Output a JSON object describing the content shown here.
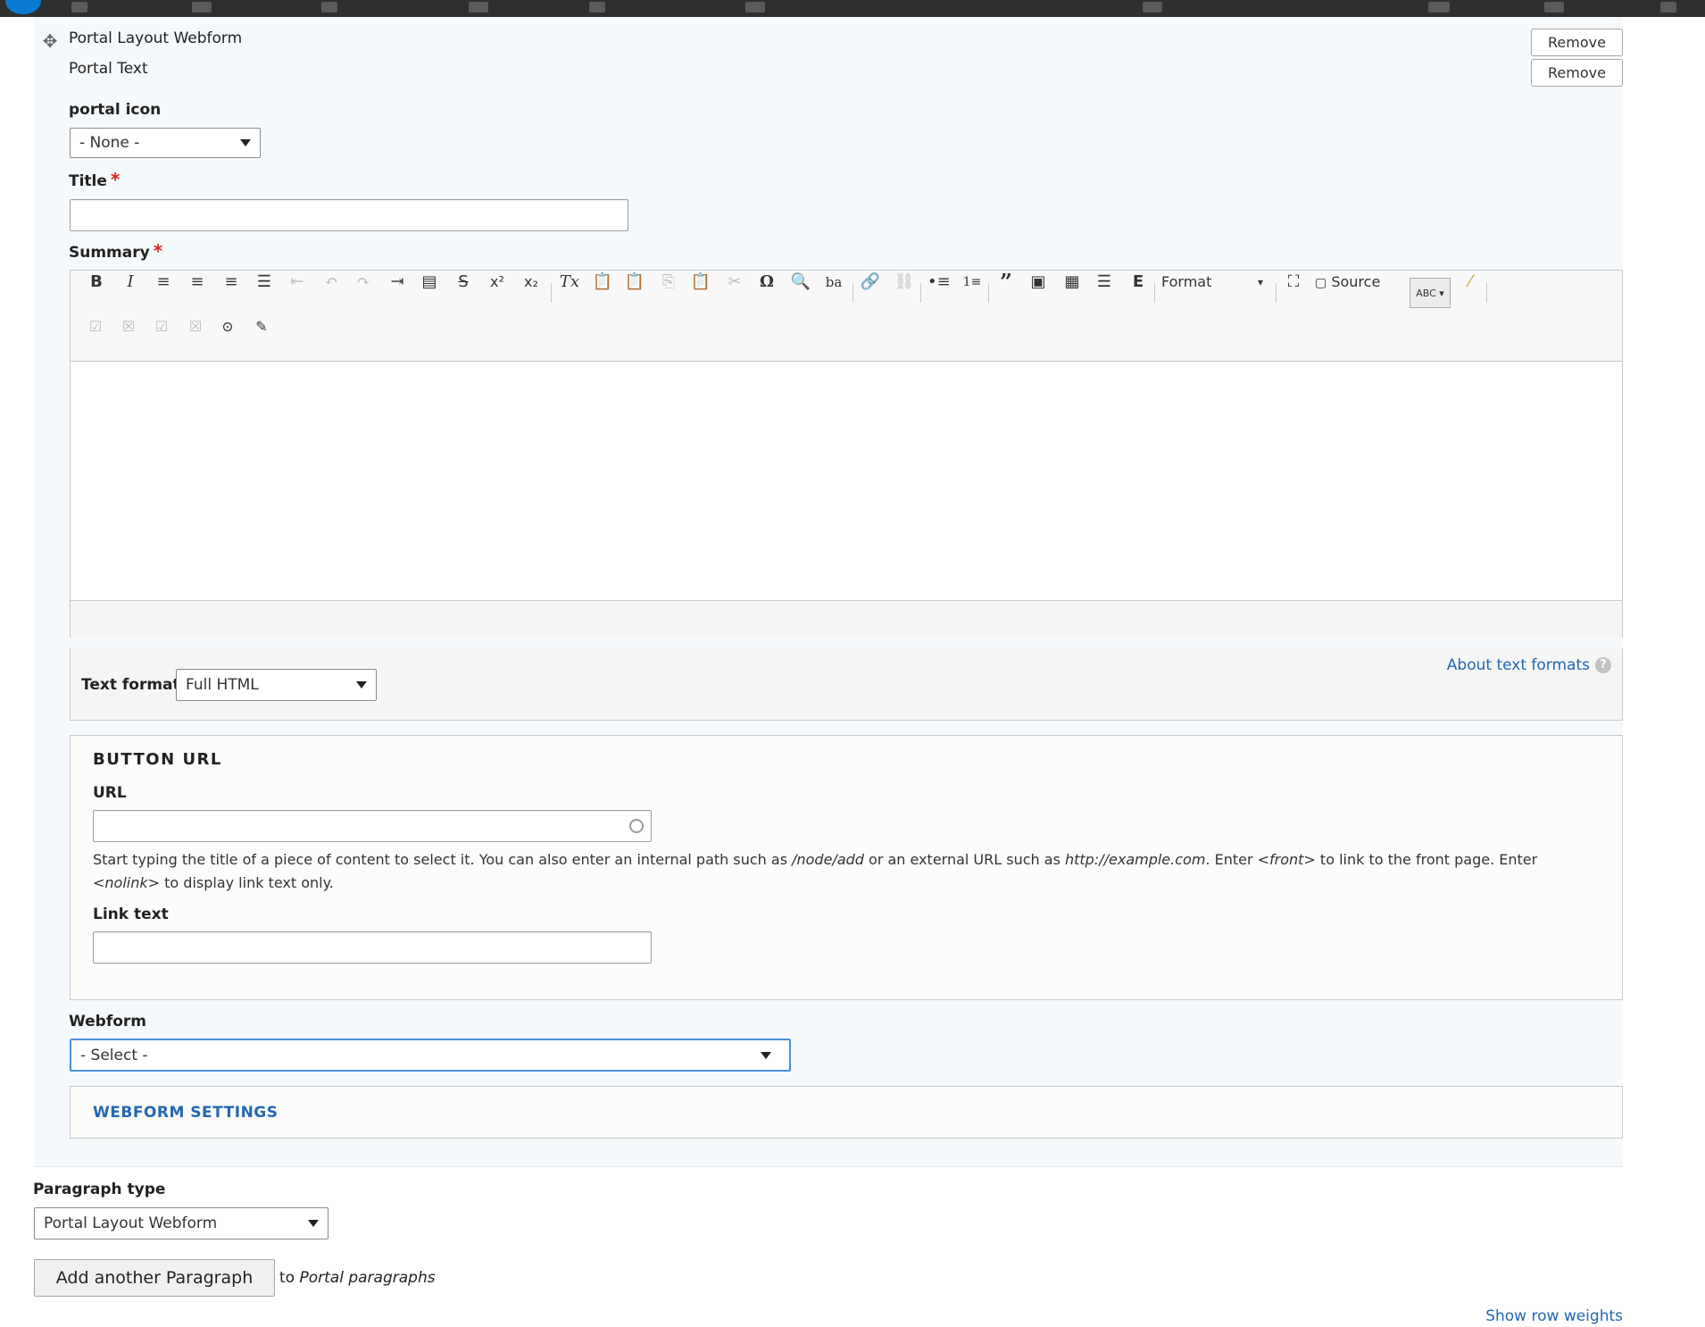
{
  "item": {
    "title": "Portal Layout Webform",
    "subtitle": "Portal Text",
    "remove_label_1": "Remove",
    "remove_label_2": "Remove"
  },
  "portal_icon": {
    "label": "portal icon",
    "value": "- None -"
  },
  "title_field": {
    "label": "Title",
    "required_mark": "*",
    "value": ""
  },
  "summary": {
    "label": "Summary",
    "required_mark": "*",
    "format_dropdown_label": "Format",
    "source_label": "Source",
    "spellcheck_label": "ABC"
  },
  "text_format": {
    "label": "Text format",
    "value": "Full HTML",
    "about_link": "About text formats",
    "help_glyph": "?"
  },
  "button_url": {
    "legend": "BUTTON URL",
    "url_label": "URL",
    "url_value": "",
    "desc_1": "Start typing the title of a piece of content to select it. You can also enter an internal path such as ",
    "desc_node_add": "/node/add",
    "desc_2": " or an external URL such as ",
    "desc_example": "http://example.com",
    "desc_3": ". Enter ",
    "desc_front": "<front>",
    "desc_4": " to link to the front page. Enter ",
    "desc_nolink": "<nolink>",
    "desc_5": " to display link text only.",
    "link_text_label": "Link text",
    "link_text_value": ""
  },
  "webform": {
    "label": "Webform",
    "value": "- Select -",
    "settings_label": "WEBFORM SETTINGS"
  },
  "paragraph_type": {
    "label": "Paragraph type",
    "value": "Portal Layout Webform",
    "add_button": "Add another Paragraph",
    "to_text": "to ",
    "target": "Portal paragraphs"
  },
  "show_row_weights": "Show row weights",
  "colors": {
    "accent_link": "#2367b2",
    "required": "#e21e1e",
    "focus_border": "#4a90d9",
    "panel_bg": "#f5f9fc"
  }
}
